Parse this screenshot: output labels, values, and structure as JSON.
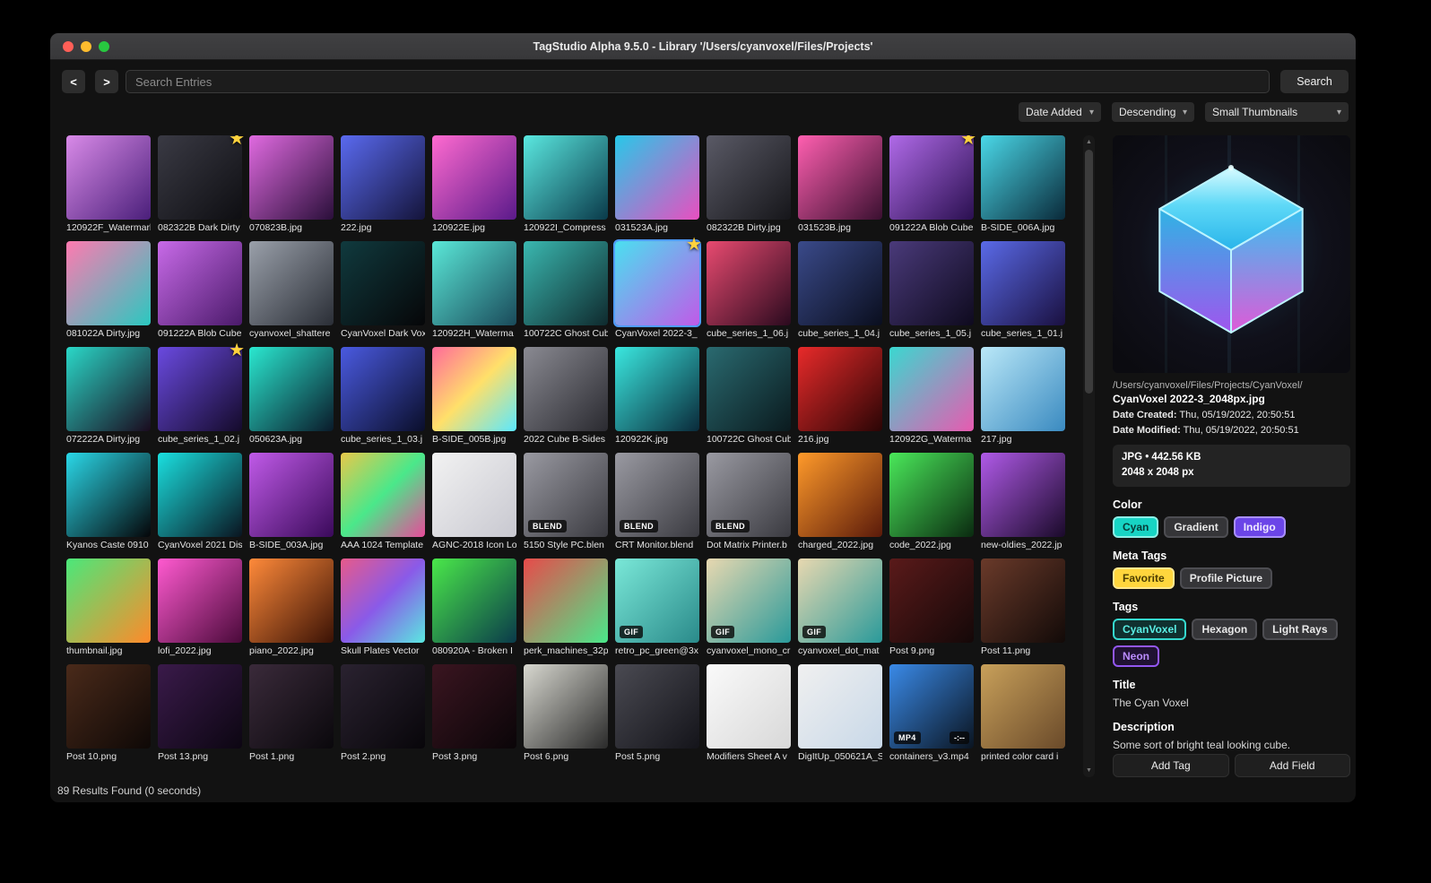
{
  "window": {
    "title": "TagStudio Alpha 9.5.0 - Library '/Users/cyanvoxel/Files/Projects'"
  },
  "toolbar": {
    "back": "<",
    "forward": ">",
    "search_placeholder": "Search Entries",
    "search_button": "Search"
  },
  "sort": {
    "field": "Date Added",
    "direction": "Descending",
    "thumb_size": "Small Thumbnails"
  },
  "status": "89 Results Found (0 seconds)",
  "thumbnails": [
    {
      "n": "120922F_Watermarl",
      "c": [
        "#d98ae8",
        "#4a1f7a"
      ]
    },
    {
      "n": "082322B Dark Dirty",
      "c": [
        "#3a3a44",
        "#0e0e12"
      ],
      "s": true
    },
    {
      "n": "070823B.jpg",
      "c": [
        "#e06ae0",
        "#2a0f3a"
      ]
    },
    {
      "n": "222.jpg",
      "c": [
        "#5a6af0",
        "#14143a"
      ]
    },
    {
      "n": "120922E.jpg",
      "c": [
        "#ff6ad0",
        "#5a1a8a"
      ]
    },
    {
      "n": "120922I_Compress",
      "c": [
        "#5ae8e0",
        "#0a3a4a"
      ]
    },
    {
      "n": "031523A.jpg",
      "c": [
        "#28c8e8",
        "#e84fc0"
      ]
    },
    {
      "n": "082322B Dirty.jpg",
      "c": [
        "#5a5a66",
        "#16161a"
      ]
    },
    {
      "n": "031523B.jpg",
      "c": [
        "#ff5fb0",
        "#3a1030"
      ]
    },
    {
      "n": "091222A Blob Cube",
      "c": [
        "#b06ae8",
        "#2a1050"
      ],
      "s": true
    },
    {
      "n": "B-SIDE_006A.jpg",
      "c": [
        "#4ad8e8",
        "#0a2a3a"
      ]
    },
    {
      "n": "081022A Dirty.jpg",
      "c": [
        "#ff7ab0",
        "#2ac8c0"
      ]
    },
    {
      "n": "091222A Blob Cube",
      "c": [
        "#c86ae8",
        "#4a1a6a"
      ]
    },
    {
      "n": "cyanvoxel_shattere",
      "c": [
        "#9aa0aa",
        "#2a2e36"
      ]
    },
    {
      "n": "CyanVoxel Dark Vox",
      "c": [
        "#103a3e",
        "#060608"
      ]
    },
    {
      "n": "120922H_Waterma",
      "c": [
        "#5ae8d8",
        "#1a4a5a"
      ]
    },
    {
      "n": "100722C Ghost Cub",
      "c": [
        "#3ab8b0",
        "#0f2a2e"
      ]
    },
    {
      "n": "CyanVoxel 2022-3_",
      "c": [
        "#4ae0f0",
        "#c05ae8"
      ],
      "s": true,
      "sel": true
    },
    {
      "n": "cube_series_1_06.j",
      "c": [
        "#e84a70",
        "#2a0a1e"
      ]
    },
    {
      "n": "cube_series_1_04.j",
      "c": [
        "#3a4a8a",
        "#0a0e1e"
      ]
    },
    {
      "n": "cube_series_1_05.j",
      "c": [
        "#4a3a7a",
        "#0e0a1e"
      ]
    },
    {
      "n": "cube_series_1_01.j",
      "c": [
        "#5a6ae8",
        "#1a1040"
      ]
    },
    {
      "n": "072222A Dirty.jpg",
      "c": [
        "#2ad8c8",
        "#1a0a1e"
      ]
    },
    {
      "n": "cube_series_1_02.j",
      "c": [
        "#6a4ae0",
        "#140a2a"
      ],
      "s": true
    },
    {
      "n": "050623A.jpg",
      "c": [
        "#2ae8d0",
        "#0a1a2a"
      ]
    },
    {
      "n": "cube_series_1_03.j",
      "c": [
        "#4a5ae0",
        "#0a0e2a"
      ]
    },
    {
      "n": "B-SIDE_005B.jpg",
      "c": [
        "#ff6a9a",
        "#ffe06a",
        "#5ae8ff"
      ]
    },
    {
      "n": "2022 Cube B-Sides",
      "c": [
        "#8a8a92",
        "#2a2a30"
      ]
    },
    {
      "n": "120922K.jpg",
      "c": [
        "#3ae8e0",
        "#0a2a3a"
      ]
    },
    {
      "n": "100722C Ghost Cub",
      "c": [
        "#2a6a70",
        "#0a1a1e"
      ]
    },
    {
      "n": "216.jpg",
      "c": [
        "#e82a2a",
        "#2a0505"
      ]
    },
    {
      "n": "120922G_Waterma",
      "c": [
        "#3ad8d0",
        "#e85ab0"
      ]
    },
    {
      "n": "217.jpg",
      "c": [
        "#bae8f8",
        "#3a8ac0"
      ]
    },
    {
      "n": "Kyanos Caste 0910",
      "c": [
        "#2ad8e8",
        "#050508"
      ]
    },
    {
      "n": "CyanVoxel 2021 Dis",
      "c": [
        "#1ae0e0",
        "#0a1420"
      ]
    },
    {
      "n": "B-SIDE_003A.jpg",
      "c": [
        "#c05ae8",
        "#3a0a5a"
      ]
    },
    {
      "n": "AAA 1024 Template",
      "c": [
        "#e8c84a",
        "#4ae88a",
        "#e84a9a"
      ]
    },
    {
      "n": "AGNC-2018 Icon Lo",
      "c": [
        "#f2f2f2",
        "#c8c8d0"
      ]
    },
    {
      "n": "5150 Style PC.blen",
      "c": [
        "#9a9aa2",
        "#3a3a40"
      ],
      "b": "BLEND"
    },
    {
      "n": "CRT Monitor.blend",
      "c": [
        "#9a9aa2",
        "#3a3a40"
      ],
      "b": "BLEND"
    },
    {
      "n": "Dot Matrix Printer.b",
      "c": [
        "#9a9aa2",
        "#3a3a40"
      ],
      "b": "BLEND"
    },
    {
      "n": "charged_2022.jpg",
      "c": [
        "#ff9a2a",
        "#5a1a0a"
      ]
    },
    {
      "n": "code_2022.jpg",
      "c": [
        "#4ae85a",
        "#0a2a10"
      ]
    },
    {
      "n": "new-oldies_2022.jp",
      "c": [
        "#b05ae8",
        "#1a0a2a"
      ]
    },
    {
      "n": "thumbnail.jpg",
      "c": [
        "#4ae87a",
        "#ff8a2a"
      ]
    },
    {
      "n": "lofi_2022.jpg",
      "c": [
        "#ff5ad0",
        "#4a0a3a"
      ]
    },
    {
      "n": "piano_2022.jpg",
      "c": [
        "#ff8a3a",
        "#3a1205"
      ]
    },
    {
      "n": "Skull Plates Vector",
      "c": [
        "#e85a8a",
        "#8a5ae8",
        "#5ae8e0"
      ]
    },
    {
      "n": "080920A - Broken I",
      "c": [
        "#4ae84a",
        "#0a3a4a"
      ]
    },
    {
      "n": "perk_machines_32p",
      "c": [
        "#e84a4a",
        "#4ae88a"
      ]
    },
    {
      "n": "retro_pc_green@3x",
      "c": [
        "#7ae8d8",
        "#2a8a8a"
      ],
      "b": "GIF"
    },
    {
      "n": "cyanvoxel_mono_cr",
      "c": [
        "#e8d8b0",
        "#2a9a9a"
      ],
      "b": "GIF"
    },
    {
      "n": "cyanvoxel_dot_mat",
      "c": [
        "#e8d8b0",
        "#2a9a9a"
      ],
      "b": "GIF"
    },
    {
      "n": "Post 9.png",
      "c": [
        "#5a1a1a",
        "#140808"
      ]
    },
    {
      "n": "Post 11.png",
      "c": [
        "#6a3a2a",
        "#120a08"
      ]
    },
    {
      "n": "Post 10.png",
      "c": [
        "#4a2a1a",
        "#0e0806"
      ]
    },
    {
      "n": "Post 13.png",
      "c": [
        "#3a1a4a",
        "#0c0612"
      ]
    },
    {
      "n": "Post 1.png",
      "c": [
        "#3a2a3a",
        "#0a080c"
      ]
    },
    {
      "n": "Post 2.png",
      "c": [
        "#2a2230",
        "#08060a"
      ]
    },
    {
      "n": "Post 3.png",
      "c": [
        "#3a1520",
        "#0a0508"
      ]
    },
    {
      "n": "Post 6.png",
      "c": [
        "#d8d8d0",
        "#2a2a2a"
      ]
    },
    {
      "n": "Post 5.png",
      "c": [
        "#4a4a52",
        "#14141a"
      ]
    },
    {
      "n": "Modifiers Sheet A v",
      "c": [
        "#fafafa",
        "#d8d8d8"
      ]
    },
    {
      "n": "DigItUp_050621A_S",
      "c": [
        "#f0f0f0",
        "#c8d8e8"
      ]
    },
    {
      "n": "containers_v3.mp4",
      "c": [
        "#3a8ae8",
        "#0a1420"
      ],
      "b": "MP4",
      "dur": "-:--"
    },
    {
      "n": "printed color card i",
      "c": [
        "#c8a05a",
        "#6a4a2a"
      ]
    }
  ],
  "preview": {
    "path": "/Users/cyanvoxel/Files/Projects/CyanVoxel/",
    "filename": "CyanVoxel 2022-3_2048px.jpg",
    "date_created_label": "Date Created:",
    "date_created": "Thu, 05/19/2022, 20:50:51",
    "date_modified_label": "Date Modified:",
    "date_modified": "Thu, 05/19/2022, 20:50:51",
    "file_info": "JPG • 442.56 KB",
    "dimensions": "2048 x 2048 px",
    "sections": {
      "color_label": "Color",
      "meta_tags_label": "Meta Tags",
      "tags_label": "Tags",
      "title_label": "Title",
      "title_value": "The Cyan Voxel",
      "description_label": "Description",
      "description_value": "Some sort of bright teal looking cube."
    },
    "color_tags": [
      {
        "label": "Cyan",
        "bg": "#17d4c4",
        "fg": "#073a36",
        "border": "#8cf0e6"
      },
      {
        "label": "Gradient",
        "bg": "#353538",
        "fg": "#e8e8e8",
        "border": "#4d4d52"
      },
      {
        "label": "Indigo",
        "bg": "#6b45e8",
        "fg": "#efe9ff",
        "border": "#a98fff"
      }
    ],
    "meta_tags": [
      {
        "label": "Favorite",
        "bg": "#ffd63d",
        "fg": "#4a3c00",
        "border": "#ffe88f"
      },
      {
        "label": "Profile Picture",
        "bg": "#353538",
        "fg": "#e8e8e8",
        "border": "#4d4d52"
      }
    ],
    "tags": [
      {
        "label": "CyanVoxel",
        "bg": "#10302f",
        "fg": "#5beee4",
        "border": "#35d8ce"
      },
      {
        "label": "Hexagon",
        "bg": "#353538",
        "fg": "#e8e8e8",
        "border": "#4d4d52"
      },
      {
        "label": "Light Rays",
        "bg": "#353538",
        "fg": "#e8e8e8",
        "border": "#4d4d52"
      },
      {
        "label": "Neon",
        "bg": "#201232",
        "fg": "#bb8cff",
        "border": "#9357f0"
      }
    ],
    "buttons": {
      "add_tag": "Add Tag",
      "add_field": "Add Field"
    }
  }
}
